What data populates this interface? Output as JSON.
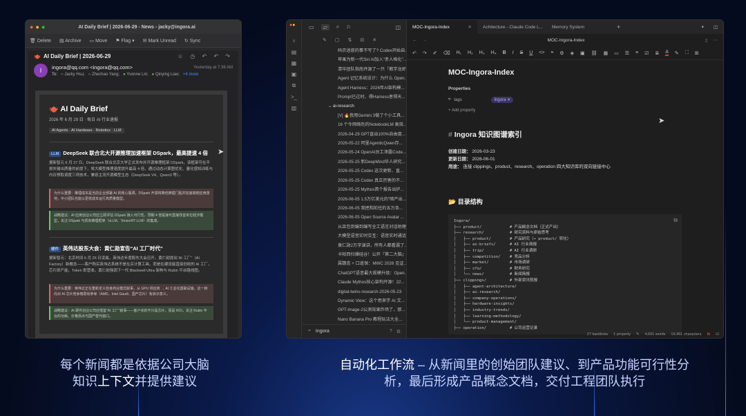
{
  "mail": {
    "title": "AI Daily Brief | 2026-06-29 - News - jacky@ingora.ai",
    "toolbar": [
      "Delete",
      "Archive",
      "Move",
      "Flag",
      "Mark Unread",
      "Sync"
    ],
    "subject": "AI Daily Brief | 2026-06-29",
    "from": "ingora@qq.com <ingora@qq.com>",
    "date": "Yesterday at 7:38 AM",
    "to_label": "To:",
    "recipients": [
      "Jacky Hsu;",
      "Zhechao Yang;",
      "Yvonne Lin;",
      "Qinying Liao;"
    ],
    "more": "+4 more",
    "brief_title": "AI Daily Brief",
    "brief_sub": "2026 年 6 月 29 日 · 每日 AI 行业速报",
    "brief_tags": "AI Agents · AI Hardware · Robotics · LLM",
    "items": [
      {
        "tag": "LLM",
        "title": "DeepSeek 联合北大开源推理加速框架 DSpark，最高提速 4 倍",
        "body": "据新智元 6 月 27 日，DeepSeek 联合北京大学正式发布并开源推理框架 DSpark，该框架可在不损失输出质量的前提下，将大模型推理速度提升最高 4 倍，通过动态计算图优化、量化感知训练与内存预取调度三项技术，兼容主流开源模型生态（DeepSeek V4、Qwen3 等）。",
        "why": "为什么重要：推理成本是当前企业部署 AI 的核心瓶颈，DSpark 开源将降低推理门槛并加速端侧应用落地，中小团队也能以更低成本运行高质量模型。",
        "rec": "战略建议：AI 应用创业公司应立即评估 DSpark 接入可行性，预期 4 倍提速可直接改善单位经济模型，关注 DSpark 与现有推理框架（vLLM、TensorRT-LLM）的集成。"
      },
      {
        "tag": "硬件",
        "title": "英伟达股东大会：黄仁勋宣告“AI 工厂时代”",
        "body": "据新智元：北京时间 6 月 26 日凌晨，英伟达年度股东大会召开，黄仁勋提出“AI 工厂”（AI Factory）新概念——客户购买英伟达系统不是在买计算工具，而是在建设能直接创收的 AI 工厂，芯片即产能，Token 即营收。黄仁勋强调下一代 Blackwell Ultra 架构与 Rubin 平台路线图。",
        "why": "为什么重要：英伟达正在重新定义自身商业模式叙事，从 GPU 供应商 → AI 工业化基础设施，这一转向对 AI 芯片竞争格局有参考（AMD、Intel Gaudi、国产芯片）有启示意义。",
        "rec": "战略建议：AI 硬件创业公司应借鉴“AI 工厂”叙事——客户买的不只是芯片，而是 ROI，关注 Rubin 平台的功耗、价格拐点与国产替代窗口。"
      }
    ]
  },
  "obs": {
    "tabs": [
      "MOC-Ingora-Index",
      "Achitecture - Claude Code L...",
      "Memory System"
    ],
    "path": "MOC-Ingora-Index",
    "sidebar_items": [
      "码农迷惑的事不写了? Codex开始自...",
      "苹果为新一代Siri AI加入\"赤人格化\"...",
      "清华团队指南开源了一只「教学龙虾」...",
      "Agent 记忆系统设计：为什么 Open...",
      "Agent Harness：2026年AI架构模...",
      "Prompt已过时，得Harness者得天..."
    ],
    "folder": "ai-research",
    "folder_items": [
      "[V] 🔥我用Gemini 3做了个小工具...",
      "16 个令网络危的NotebookLM 高效...",
      "2026-04-29 GPT直出100%自由度...",
      "2026-05-22 阿里AgenticQwen存...",
      "2026-05-24 OpenAI员工泄露Code...",
      "2026-05-25 新DeepMind华人研究...",
      "2026-05-25 Codex 这次更新、直...",
      "2026-05-25 Codex 真正厉害的不...",
      "2026-05-25 Mythos首个报告出炉...",
      "2026-06-05 1.5万亿美元的\"暗产出...",
      "2026-06-05 我把和前任的五万条...",
      "2026-06-05 Open Source Avatar ...",
      "从且包到编到编写全工语言对话助理...",
      "大模型语音实时交互：语音实时通话...",
      "黄仁勋2万字演讲，所有人都看漏了...",
      "卡帕西扫爆硅谷！公开『第二大脑』...",
      "属魏态 + 口遥保：MWC 2026 见证...",
      "ChatGPT语音最大规模升级：Open...",
      "Claude Mythos核心架构开源！22...",
      "digital-twins-research-2026-05-23",
      "Dynamic View：这个用来学 AI 文...",
      "GPT-image-2公测效果炸场了，那...",
      "Nano Banana Pro 教程玩法大全..."
    ],
    "vault": "Ingora",
    "doc_title": "MOC-Ingora-Index",
    "props_label": "Properties",
    "tags_key": "tags",
    "tags_val": "Ingora",
    "add_prop": "Add property",
    "h1": "Ingora 知识图谱索引",
    "meta": [
      {
        "k": "创建日期：",
        "v": "2026-03-23"
      },
      {
        "k": "更新日期：",
        "v": "2026-06-01"
      },
      {
        "k": "用途：",
        "v": "连接 clippings、product、research、operation 四大知识库的双向链接中心"
      }
    ],
    "h2": "📂 目录结构",
    "code": [
      "Ingora/",
      "├── product/            # 产品概念文档（正式产出）",
      "├── research/           # 研究资料与原始思考",
      "│   ├── product/        # 产品研究（→ product/ 转化）",
      "│   ├── ai-briefs/      # AI 行业简报",
      "│   ├── trip/           # AI 行业调研",
      "│   ├── competition/    # 竞品分析",
      "│   ├── market/         # 市场调研",
      "│   ├── cfo/            # 财务研究",
      "│   └── news/           # 新闻简报",
      "├── clippings/          # 外部资讯剪报",
      "│   ├── agent-architecture/",
      "│   ├── ai-research/",
      "│   ├── company-operations/",
      "│   ├── hardware-insights/",
      "│   ├── industry-trends/",
      "│   ├── learning-methodology/",
      "│   └── product-management/",
      "├── operation/          # 公司运营记录"
    ],
    "status": [
      "27 backlinks",
      "1 property",
      "4,691 words",
      "19,451 characters"
    ]
  },
  "captions": {
    "left_l1": "每个新闻都是依据公司大脑",
    "left_l2_a": "知识",
    "left_l2_b": "上下文",
    "left_l2_c": "并提供建议",
    "right_l1_a": "自动化工作流",
    "right_l1_b": " – 从新闻里的创始团队建议、到产品功能可行性分",
    "right_l2": "析，最后形成产品概念文档，交付工程团队执行"
  }
}
